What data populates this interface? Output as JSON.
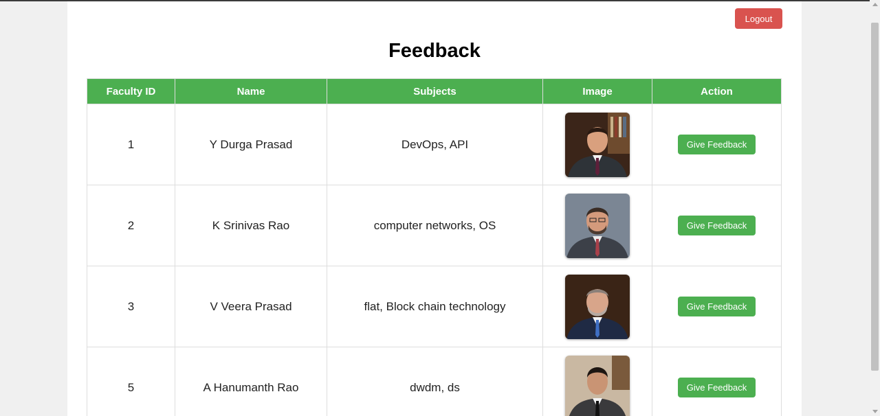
{
  "header": {
    "logout_label": "Logout",
    "title": "Feedback"
  },
  "table": {
    "columns": [
      "Faculty ID",
      "Name",
      "Subjects",
      "Image",
      "Action"
    ],
    "rows": [
      {
        "id": "1",
        "name": "Y Durga Prasad",
        "subjects": "DevOps, API",
        "action_label": "Give Feedback"
      },
      {
        "id": "2",
        "name": "K Srinivas Rao",
        "subjects": "computer networks, OS",
        "action_label": "Give Feedback"
      },
      {
        "id": "3",
        "name": "V Veera Prasad",
        "subjects": "flat, Block chain technology",
        "action_label": "Give Feedback"
      },
      {
        "id": "5",
        "name": "A Hanumanth Rao",
        "subjects": "dwdm, ds",
        "action_label": "Give Feedback"
      }
    ]
  },
  "colors": {
    "header_green": "#4caf50",
    "button_green": "#4caf50",
    "logout_red": "#d9534f",
    "border": "#dddddd"
  },
  "icons": {
    "faculty_photo": "portrait-photo"
  }
}
